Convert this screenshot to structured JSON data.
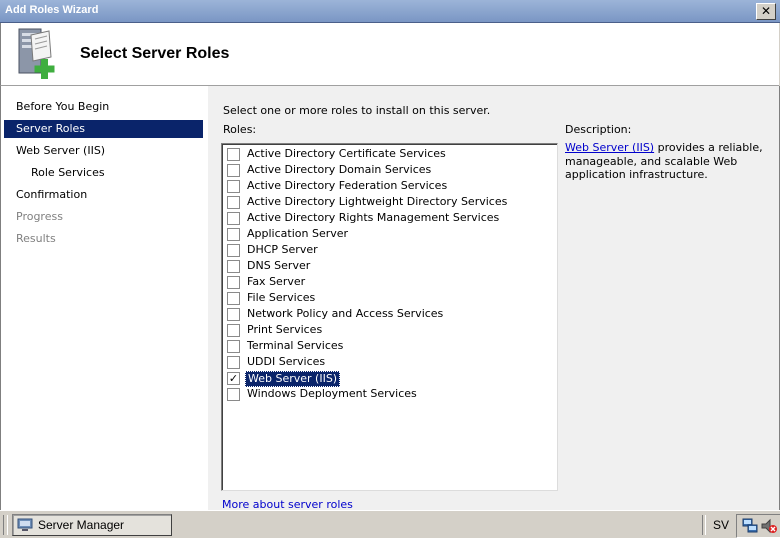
{
  "window": {
    "title": "Add Roles Wizard",
    "close_glyph": "✕"
  },
  "header": {
    "title": "Select Server Roles",
    "icon": "server-add-icon"
  },
  "nav": {
    "items": [
      {
        "label": "Before You Begin",
        "state": "normal"
      },
      {
        "label": "Server Roles",
        "state": "selected"
      },
      {
        "label": "Web Server (IIS)",
        "state": "normal"
      },
      {
        "label": "Role Services",
        "state": "normal",
        "indent": true
      },
      {
        "label": "Confirmation",
        "state": "normal"
      },
      {
        "label": "Progress",
        "state": "disabled"
      },
      {
        "label": "Results",
        "state": "disabled"
      }
    ]
  },
  "main": {
    "instruction": "Select one or more roles to install on this server.",
    "roles_label": "Roles:",
    "roles": [
      {
        "label": "Active Directory Certificate Services",
        "checked": false
      },
      {
        "label": "Active Directory Domain Services",
        "checked": false
      },
      {
        "label": "Active Directory Federation Services",
        "checked": false
      },
      {
        "label": "Active Directory Lightweight Directory Services",
        "checked": false
      },
      {
        "label": "Active Directory Rights Management Services",
        "checked": false
      },
      {
        "label": "Application Server",
        "checked": false
      },
      {
        "label": "DHCP Server",
        "checked": false
      },
      {
        "label": "DNS Server",
        "checked": false
      },
      {
        "label": "Fax Server",
        "checked": false
      },
      {
        "label": "File Services",
        "checked": false
      },
      {
        "label": "Network Policy and Access Services",
        "checked": false
      },
      {
        "label": "Print Services",
        "checked": false
      },
      {
        "label": "Terminal Services",
        "checked": false
      },
      {
        "label": "UDDI Services",
        "checked": false
      },
      {
        "label": "Web Server (IIS)",
        "checked": true
      },
      {
        "label": "Windows Deployment Services",
        "checked": false
      }
    ],
    "more_link": "More about server roles",
    "description_label": "Description:",
    "description_link": "Web Server (IIS)",
    "description_text": " provides a reliable, manageable, and scalable Web application infrastructure."
  },
  "taskbar": {
    "button_label": "Server Manager",
    "button_icon": "server-manager-icon",
    "language": "SV",
    "tray_icons": [
      "network-icon",
      "volume-muted-icon"
    ]
  }
}
